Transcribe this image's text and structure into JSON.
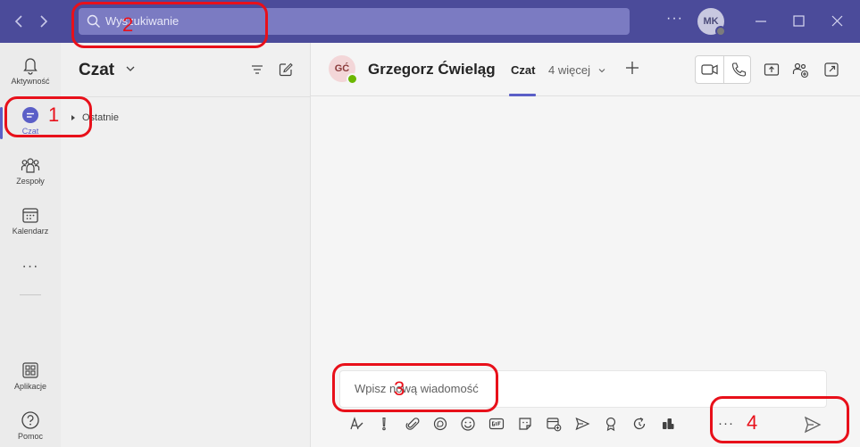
{
  "titlebar": {
    "search_placeholder": "Wyszukiwanie",
    "more": "···",
    "user_initials": "MK"
  },
  "rail": {
    "items": [
      {
        "label": "Aktywność",
        "icon": "bell-icon"
      },
      {
        "label": "Czat",
        "icon": "chat-icon"
      },
      {
        "label": "Zespoły",
        "icon": "teams-icon"
      },
      {
        "label": "Kalendarz",
        "icon": "calendar-icon"
      },
      {
        "label": "Aplikacje",
        "icon": "apps-icon"
      },
      {
        "label": "Pomoc",
        "icon": "help-icon"
      }
    ],
    "more": "···"
  },
  "chatlist": {
    "title": "Czat",
    "section_recent": "Ostatnie"
  },
  "main": {
    "contact_initials": "GĆ",
    "contact_name": "Grzegorz Ćwieląg",
    "tab_chat": "Czat",
    "tab_more": "4 więcej",
    "compose_placeholder": "Wpisz nową wiadomość",
    "more": "···"
  },
  "annotations": [
    "1",
    "2",
    "3",
    "4"
  ],
  "colors": {
    "titlebar": "#4b4b9a",
    "accent": "#5b5fc7",
    "annotation": "#e8101a",
    "presence_available": "#6bb700"
  }
}
